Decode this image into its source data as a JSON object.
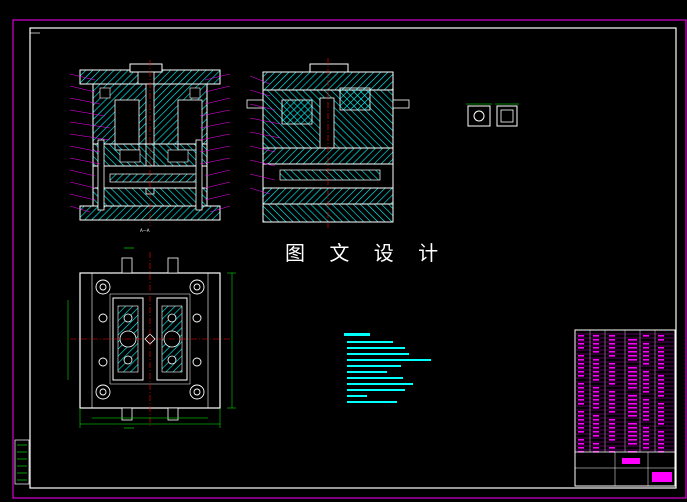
{
  "watermark": "图 文 设 计",
  "section_label": "A—A",
  "colors": {
    "background": "#000000",
    "frame": "#ff00ff",
    "outline": "#ffffff",
    "hatch": "#00ffff",
    "centerline": "#ff0000",
    "dimension": "#00ff00",
    "leader": "#ff00ff"
  }
}
